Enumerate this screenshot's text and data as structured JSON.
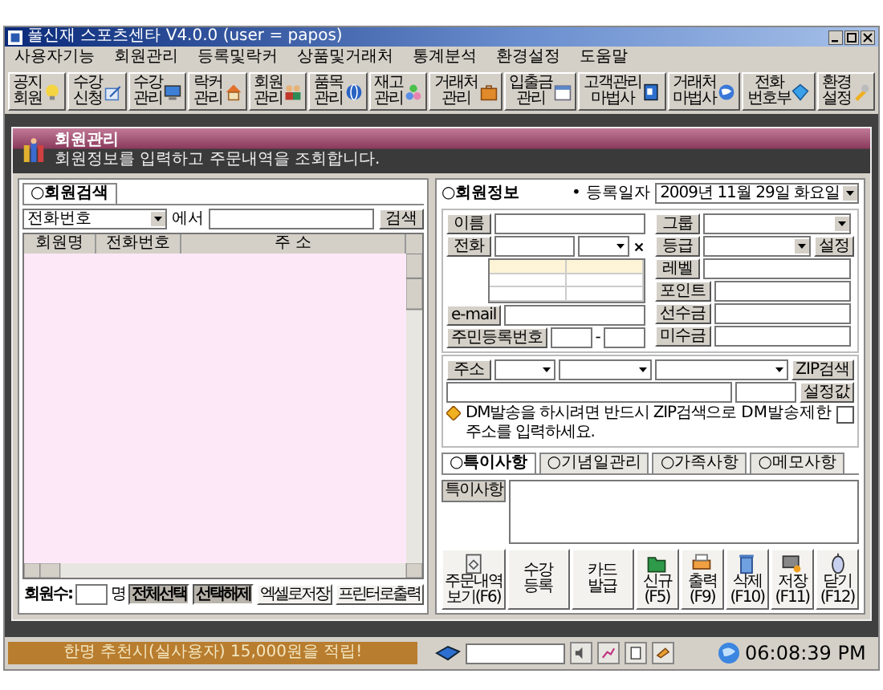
{
  "window": {
    "title": "풀신재 스포츠센타 V4.0.0 (user = papos)"
  },
  "menu": [
    "사용자기능",
    "회원관리",
    "등록및락커",
    "상품및거래처",
    "통계분석",
    "환경설정",
    "도움말"
  ],
  "toolbar": [
    {
      "lines": [
        "공지",
        "회원"
      ]
    },
    {
      "lines": [
        "수강",
        "신청"
      ]
    },
    {
      "lines": [
        "수강",
        "관리"
      ]
    },
    {
      "lines": [
        "락커",
        "관리"
      ]
    },
    {
      "lines": [
        "회원",
        "관리"
      ]
    },
    {
      "lines": [
        "품목",
        "관리"
      ]
    },
    {
      "lines": [
        "재고",
        "관리"
      ]
    },
    {
      "lines": [
        "거래처",
        "관리"
      ]
    },
    {
      "lines": [
        "입출금",
        "관리"
      ]
    },
    {
      "lines": [
        "고객관리",
        "마법사"
      ]
    },
    {
      "lines": [
        "거래처",
        "마법사"
      ]
    },
    {
      "lines": [
        "전화",
        "번호부"
      ]
    },
    {
      "lines": [
        "환경",
        "설정"
      ]
    }
  ],
  "panel": {
    "title": "회원관리",
    "subtitle": "회원정보를 입력하고 주문내역을 조회합니다."
  },
  "search": {
    "tab": {
      "label": "○회원검색",
      "selected": true
    },
    "field": "전화번호",
    "connector": "에서",
    "button": "검색",
    "columns": [
      "회원명",
      "전화번호",
      "주 소"
    ],
    "count_label": "회원수:",
    "count_unit": "명",
    "buttons": [
      {
        "label": "전체선택",
        "kind": "pressed"
      },
      {
        "label": "선택해제",
        "kind": "pressed"
      },
      {
        "label": "엑셀로저장",
        "kind": "plain"
      },
      {
        "label": "프린터로출력",
        "kind": "plain"
      }
    ]
  },
  "info": {
    "title": "○회원정보",
    "date_label": "• 등록일자",
    "date": "2009년 11월 29일 화요일",
    "left_fields": [
      {
        "label": "이름",
        "kind": "text"
      },
      {
        "label": "전화",
        "kind": "phone"
      },
      {
        "label": "e-mail",
        "kind": "text"
      },
      {
        "label": "주민등록번호",
        "kind": "id"
      }
    ],
    "id_separator": "-",
    "right_fields": [
      {
        "label": "그룹",
        "kind": "select"
      },
      {
        "label": "등급",
        "kind": "select",
        "button": "설정"
      },
      {
        "label": "레벨",
        "kind": "text"
      },
      {
        "label": "포인트",
        "kind": "text"
      },
      {
        "label": "선수금",
        "kind": "text"
      },
      {
        "label": "미수금",
        "kind": "text"
      }
    ],
    "address": {
      "label": "주소",
      "zip_button": "ZIP검색",
      "setting_button": "설정값",
      "note": "DM발송을 하시려면 반드시 ZIP검색으로 주소를 입력하세요.",
      "dm_label": "DM발송제한",
      "dm_checked": false
    }
  },
  "notes_tabs": [
    {
      "label": "○특이사항",
      "selected": true
    },
    {
      "label": "○기념일관리",
      "selected": false
    },
    {
      "label": "○가족사항",
      "selected": false
    },
    {
      "label": "○메모사항",
      "selected": false
    }
  ],
  "notes_label": "특이사항",
  "actions": [
    {
      "label": "주문내역보기(F6)",
      "kind": "icon"
    },
    {
      "label": "수강등록",
      "kind": "text"
    },
    {
      "label": "카드발급",
      "kind": "text"
    },
    {
      "label": "신규(F5)",
      "kind": "icon"
    },
    {
      "label": "출력(F9)",
      "kind": "icon"
    },
    {
      "label": "삭제(F10)",
      "kind": "icon"
    },
    {
      "label": "저장(F11)",
      "kind": "icon"
    },
    {
      "label": "닫기(F12)",
      "kind": "icon"
    }
  ],
  "status_bar": {
    "message": "한명 추천시(실사용자) 15,000원을 적립!",
    "time": "06:08:39 PM"
  }
}
